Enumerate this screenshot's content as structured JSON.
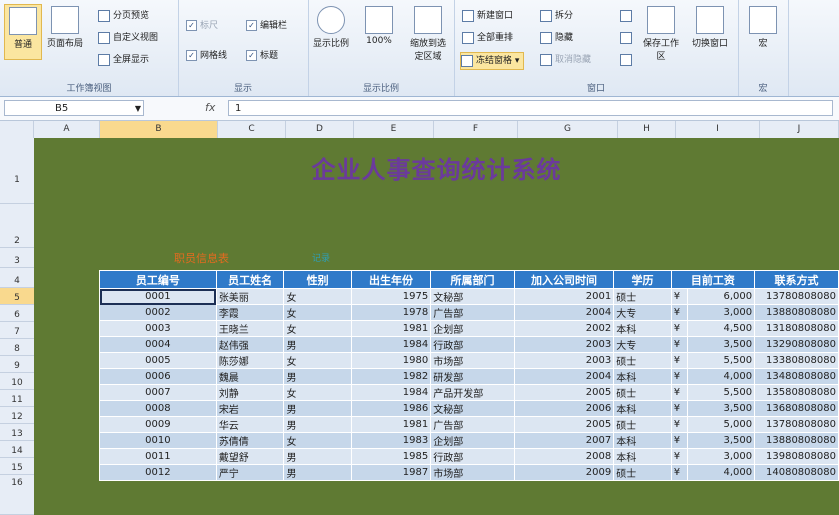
{
  "ribbon": {
    "view_group": {
      "normal": "普通",
      "page_layout": "页面布局",
      "page_break": "分页预览",
      "custom_views": "自定义视图",
      "full_screen": "全屏显示",
      "title": "工作簿视图"
    },
    "show_group": {
      "ruler": "标尺",
      "formula_bar": "编辑栏",
      "gridlines": "网格线",
      "headings": "标题",
      "title": "显示"
    },
    "zoom_group": {
      "zoom": "显示比例",
      "hundred": "100%",
      "zoom_selection": "缩放到选定区域",
      "title": "显示比例"
    },
    "window_group": {
      "new_window": "新建窗口",
      "arrange_all": "全部重排",
      "freeze_panes": "冻结窗格",
      "split": "拆分",
      "hide": "隐藏",
      "unhide": "取消隐藏",
      "save_workspace": "保存工作区",
      "switch_windows": "切换窗口",
      "title": "窗口"
    },
    "macro_group": {
      "macros": "宏",
      "title": "宏"
    }
  },
  "formula_bar": {
    "name_box": "B5",
    "fx": "fx",
    "formula": "1"
  },
  "columns": [
    "A",
    "B",
    "C",
    "D",
    "E",
    "F",
    "G",
    "H",
    "I",
    "J"
  ],
  "rows": [
    "1",
    "2",
    "3",
    "4",
    "5",
    "6",
    "7",
    "8",
    "9",
    "10",
    "11",
    "12",
    "13",
    "14",
    "15",
    "16"
  ],
  "sheet": {
    "title": "企业人事查询统计系统",
    "subtitle_orange": "职员信息表",
    "subtitle_teal": "记录"
  },
  "table": {
    "headers": [
      "员工编号",
      "员工姓名",
      "性别",
      "出生年份",
      "所属部门",
      "加入公司时间",
      "学历",
      "目前工资",
      "联系方式"
    ],
    "rows": [
      [
        "0001",
        "张美丽",
        "女",
        "1975",
        "文秘部",
        "2001",
        "硕士",
        "¥",
        "6,000",
        "13780808080"
      ],
      [
        "0002",
        "李霞",
        "女",
        "1978",
        "广告部",
        "2004",
        "大专",
        "¥",
        "3,000",
        "13880808080"
      ],
      [
        "0003",
        "王晓兰",
        "女",
        "1981",
        "企划部",
        "2002",
        "本科",
        "¥",
        "4,500",
        "13180808080"
      ],
      [
        "0004",
        "赵伟强",
        "男",
        "1984",
        "行政部",
        "2003",
        "大专",
        "¥",
        "3,500",
        "13290808080"
      ],
      [
        "0005",
        "陈莎娜",
        "女",
        "1980",
        "市场部",
        "2003",
        "硕士",
        "¥",
        "5,500",
        "13380808080"
      ],
      [
        "0006",
        "魏晨",
        "男",
        "1982",
        "研发部",
        "2004",
        "本科",
        "¥",
        "4,000",
        "13480808080"
      ],
      [
        "0007",
        "刘静",
        "女",
        "1984",
        "产品开发部",
        "2005",
        "硕士",
        "¥",
        "5,500",
        "13580808080"
      ],
      [
        "0008",
        "宋岩",
        "男",
        "1986",
        "文秘部",
        "2006",
        "本科",
        "¥",
        "3,500",
        "13680808080"
      ],
      [
        "0009",
        "华云",
        "男",
        "1981",
        "广告部",
        "2005",
        "硕士",
        "¥",
        "5,000",
        "13780808080"
      ],
      [
        "0010",
        "苏倩倩",
        "女",
        "1983",
        "企划部",
        "2007",
        "本科",
        "¥",
        "3,500",
        "13880808080"
      ],
      [
        "0011",
        "戴望舒",
        "男",
        "1985",
        "行政部",
        "2008",
        "本科",
        "¥",
        "3,000",
        "13980808080"
      ],
      [
        "0012",
        "严宁",
        "男",
        "1987",
        "市场部",
        "2009",
        "硕士",
        "¥",
        "4,000",
        "14080808080"
      ]
    ]
  }
}
